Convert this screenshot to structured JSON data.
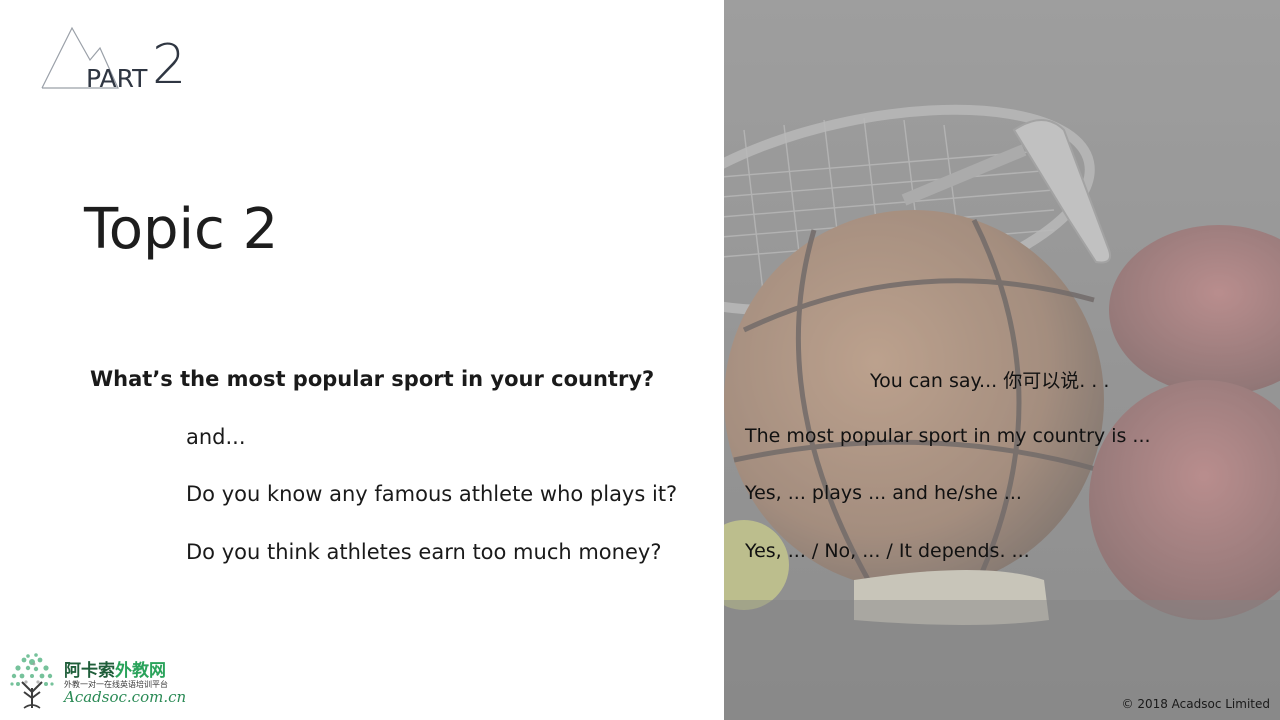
{
  "part": {
    "label": "PART",
    "number": "2"
  },
  "topic": {
    "title": "Topic 2"
  },
  "questions": {
    "main": "What’s the most popular sport in your country?",
    "followups": [
      "and...",
      "Do you know any famous athlete who plays it?",
      "Do you think athletes earn too much money?"
    ]
  },
  "answers": {
    "heading": "You can say... 你可以说. . .",
    "lines": [
      "The most popular sport in my country is ...",
      "Yes, ... plays ... and he/she ...",
      "Yes, ... / No, ... / It depends. ..."
    ]
  },
  "logo": {
    "cn_main": "阿卡索",
    "cn_accent": "外教网",
    "tagline": "外教一对一在线英语培训平台",
    "en": "Acadsoc.com.cn"
  },
  "footer": {
    "copyright": "© 2018 Acadsoc Limited"
  },
  "colors": {
    "title_text": "#1d1d1d",
    "part_text": "#2f3642",
    "logo_green": "#2aa35b",
    "photo_bg": "#8a8a8a"
  }
}
